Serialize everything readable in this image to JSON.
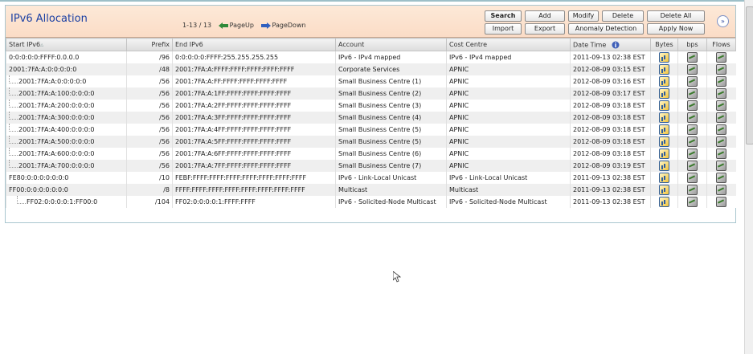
{
  "panel": {
    "title": "IPv6 Allocation",
    "pager": {
      "range": "1-13 / 13",
      "page_up": "PageUp",
      "page_down": "PageDown"
    },
    "buttons": {
      "search": "Search",
      "add": "Add",
      "modify": "Modify",
      "delete": "Delete",
      "delete_all": "Delete All",
      "import": "Import",
      "export": "Export",
      "anomaly": "Anomaly Detection",
      "apply_now": "Apply Now"
    },
    "collapse_glyph": "»"
  },
  "table": {
    "headers": {
      "start": "Start IPv6",
      "prefix": "Prefix",
      "end": "End IPv6",
      "account": "Account",
      "cost": "Cost Centre",
      "date": "Date Time",
      "bytes": "Bytes",
      "bps": "bps",
      "flows": "Flows"
    },
    "rows": [
      {
        "level": 0,
        "start": "0:0:0:0:0:FFFF:0.0.0.0",
        "prefix": "/96",
        "end": "0:0:0:0:0:FFFF:255.255.255.255",
        "account": "IPv6 - IPv4 mapped",
        "cost": "IPv6 - IPv4 mapped",
        "date": "2011-09-13 02:38 EST"
      },
      {
        "level": 0,
        "start": "2001:7FA:A:0:0:0:0:0",
        "prefix": "/48",
        "end": "2001:7FA:A:FFFF:FFFF:FFFF:FFFF:FFFF",
        "account": "Corporate Services",
        "cost": "APNIC",
        "date": "2012-08-09 03:15 EST"
      },
      {
        "level": 1,
        "start": "2001:7FA:A:0:0:0:0:0",
        "prefix": "/56",
        "end": "2001:7FA:A:FF:FFFF:FFFF:FFFF:FFFF",
        "account": "Small Business Centre (1)",
        "cost": "APNIC",
        "date": "2012-08-09 03:16 EST"
      },
      {
        "level": 1,
        "start": "2001:7FA:A:100:0:0:0:0",
        "prefix": "/56",
        "end": "2001:7FA:A:1FF:FFFF:FFFF:FFFF:FFFF",
        "account": "Small Business Centre (2)",
        "cost": "APNIC",
        "date": "2012-08-09 03:17 EST"
      },
      {
        "level": 1,
        "start": "2001:7FA:A:200:0:0:0:0",
        "prefix": "/56",
        "end": "2001:7FA:A:2FF:FFFF:FFFF:FFFF:FFFF",
        "account": "Small Business Centre (3)",
        "cost": "APNIC",
        "date": "2012-08-09 03:18 EST"
      },
      {
        "level": 1,
        "start": "2001:7FA:A:300:0:0:0:0",
        "prefix": "/56",
        "end": "2001:7FA:A:3FF:FFFF:FFFF:FFFF:FFFF",
        "account": "Small Business Centre (4)",
        "cost": "APNIC",
        "date": "2012-08-09 03:18 EST"
      },
      {
        "level": 1,
        "start": "2001:7FA:A:400:0:0:0:0",
        "prefix": "/56",
        "end": "2001:7FA:A:4FF:FFFF:FFFF:FFFF:FFFF",
        "account": "Small Business Centre (5)",
        "cost": "APNIC",
        "date": "2012-08-09 03:18 EST"
      },
      {
        "level": 1,
        "start": "2001:7FA:A:500:0:0:0:0",
        "prefix": "/56",
        "end": "2001:7FA:A:5FF:FFFF:FFFF:FFFF:FFFF",
        "account": "Small Business Centre (5)",
        "cost": "APNIC",
        "date": "2012-08-09 03:18 EST"
      },
      {
        "level": 1,
        "start": "2001:7FA:A:600:0:0:0:0",
        "prefix": "/56",
        "end": "2001:7FA:A:6FF:FFFF:FFFF:FFFF:FFFF",
        "account": "Small Business Centre (6)",
        "cost": "APNIC",
        "date": "2012-08-09 03:18 EST"
      },
      {
        "level": 1,
        "start": "2001:7FA:A:700:0:0:0:0",
        "prefix": "/56",
        "end": "2001:7FA:A:7FF:FFFF:FFFF:FFFF:FFFF",
        "account": "Small Business Centre (7)",
        "cost": "APNIC",
        "date": "2012-08-09 03:19 EST"
      },
      {
        "level": 0,
        "start": "FE80:0:0:0:0:0:0:0",
        "prefix": "/10",
        "end": "FEBF:FFFF:FFFF:FFFF:FFFF:FFFF:FFFF:FFFF",
        "account": "IPv6 - Link-Local Unicast",
        "cost": "IPv6 - Link-Local Unicast",
        "date": "2011-09-13 02:38 EST"
      },
      {
        "level": 0,
        "start": "FF00:0:0:0:0:0:0:0",
        "prefix": "/8",
        "end": "FFFF:FFFF:FFFF:FFFF:FFFF:FFFF:FFFF:FFFF",
        "account": "Multicast",
        "cost": "Multicast",
        "date": "2011-09-13 02:38 EST"
      },
      {
        "level": 2,
        "start": "FF02:0:0:0:0:1:FF00:0",
        "prefix": "/104",
        "end": "FF02:0:0:0:0:1:FFFF:FFFF",
        "account": "IPv6 - Solicited-Node Multicast",
        "cost": "IPv6 - Solicited-Node Multicast",
        "date": "2011-09-13 02:38 EST"
      }
    ]
  },
  "icons": {
    "bytes": "bar-chart-icon",
    "bps": "graph-icon",
    "flows": "graph-icon",
    "date_info": "info-icon",
    "page_up": "arrow-left-icon",
    "page_down": "arrow-right-icon"
  },
  "colors": {
    "title": "#1a3fa3",
    "header_bg": "#fbdcc6",
    "border": "#a9c6cf"
  }
}
